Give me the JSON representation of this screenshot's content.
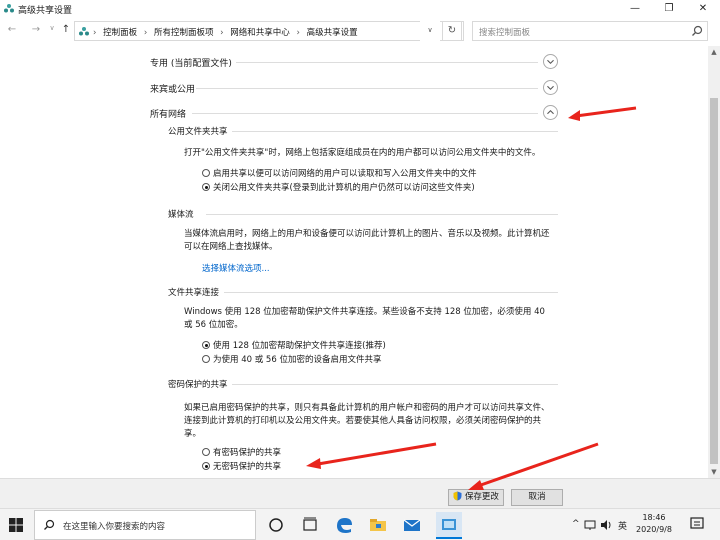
{
  "window": {
    "title": "高级共享设置",
    "minimize": "—",
    "maximize": "❐",
    "close": "✕"
  },
  "address": {
    "back": "←",
    "forward": "→",
    "dropdown": "∨",
    "up": "↑",
    "crumbs": [
      "控制面板",
      "所有控制面板项",
      "网络和共享中心",
      "高级共享设置"
    ],
    "crumb_sep": "›",
    "history_dropdown": "∨",
    "refresh": "↻",
    "search_placeholder": "搜索控制面板"
  },
  "sections": {
    "private": "专用 (当前配置文件)",
    "guest": "来宾或公用",
    "all": "所有网络"
  },
  "public_folder": {
    "heading": "公用文件夹共享",
    "description": "打开\"公用文件夹共享\"时，网络上包括家庭组成员在内的用户都可以访问公用文件夹中的文件。",
    "option1": "启用共享以便可以访问网络的用户可以读取和写入公用文件夹中的文件",
    "option2": "关闭公用文件夹共享(登录到此计算机的用户仍然可以访问这些文件夹)",
    "selected": 2
  },
  "media": {
    "heading": "媒体流",
    "description": "当媒体流启用时，网络上的用户和设备便可以访问此计算机上的图片、音乐以及视频。此计算机还可以在网络上查找媒体。",
    "link": "选择媒体流选项..."
  },
  "file_sharing": {
    "heading": "文件共享连接",
    "description": "Windows 使用 128 位加密帮助保护文件共享连接。某些设备不支持 128 位加密，必须使用 40 或 56 位加密。",
    "option1": "使用 128 位加密帮助保护文件共享连接(推荐)",
    "option2": "为使用 40 或 56 位加密的设备启用文件共享",
    "selected": 1
  },
  "password": {
    "heading": "密码保护的共享",
    "description": "如果已启用密码保护的共享，则只有具备此计算机的用户帐户和密码的用户才可以访问共享文件、连接到此计算机的打印机以及公用文件夹。若要使其他人具备访问权限，必须关闭密码保护的共享。",
    "option1": "有密码保护的共享",
    "option2": "无密码保护的共享",
    "selected": 2
  },
  "footer": {
    "save": "保存更改",
    "cancel": "取消"
  },
  "taskbar": {
    "search_placeholder": "在这里输入你要搜索的内容",
    "tray_up": "^",
    "ime": "英",
    "time": "18:46",
    "date": "2020/9/8"
  },
  "colors": {
    "accent": "#0078d7",
    "link": "#0066cc",
    "annotation_arrow": "#e8241c"
  }
}
